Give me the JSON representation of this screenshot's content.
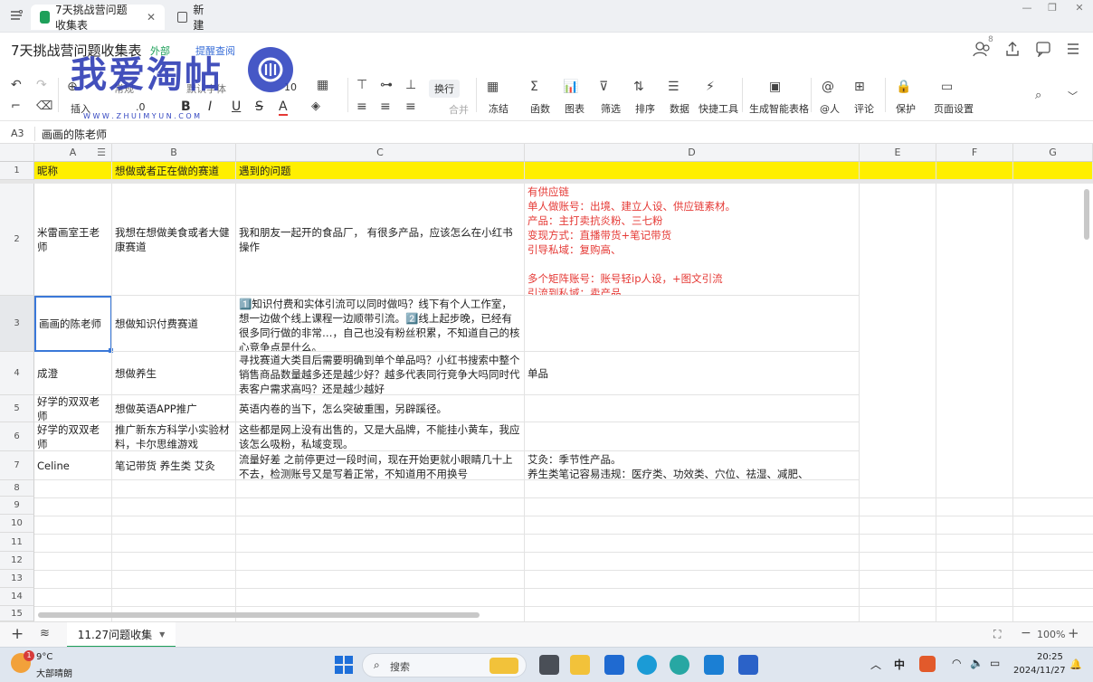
{
  "tabs": [
    {
      "label": "7天挑战营问题收集表"
    },
    {
      "label": "新建"
    }
  ],
  "doc": {
    "title": "7天挑战营问题收集表",
    "badge": "外部",
    "notify": "提醒查阅",
    "collab_count": "8"
  },
  "toolbar": {
    "insert": "插入",
    "normal": "常规",
    "font": "默认字体",
    "size": "10",
    "wrap": "换行",
    "merge": "合并",
    "decimal": ".0",
    "bold": "B",
    "italic": "I",
    "underline": "U",
    "strike": "S",
    "color": "A",
    "items": [
      "冻结",
      "函数",
      "图表",
      "筛选",
      "排序",
      "数据",
      "快捷工具",
      "生成智能表格",
      "@人",
      "评论",
      "保护",
      "页面设置"
    ]
  },
  "formula": {
    "ref": "A3",
    "value": "画画的陈老师"
  },
  "columns": [
    "A",
    "B",
    "C",
    "D",
    "E",
    "F",
    "G"
  ],
  "rows": [
    "1",
    "2",
    "3",
    "4",
    "5",
    "6",
    "7",
    "8",
    "9",
    "10",
    "11",
    "12",
    "13",
    "14",
    "15"
  ],
  "header_row": [
    "昵称",
    "想做或者正在做的赛道",
    "遇到的问题",
    ""
  ],
  "data": [
    {
      "a": "米雷画室王老师",
      "b": "我想在想做美食或者大健康赛道",
      "c": "我和朋友一起开的食品厂， 有很多产品，应该怎么在小红书操作",
      "d": [
        "有供应链",
        "单人做账号：出境、建立人设、供应链素材。",
        "产品：主打卖抗炎粉、三七粉",
        "变现方式：直播带货+笔记带货",
        "引导私域：复购高、",
        "",
        "多个矩阵账号：账号轻ip人设，+图文引流",
        "引流到私域：卖产品"
      ]
    },
    {
      "a": "画画的陈老师",
      "b": "想做知识付费赛道",
      "c": "1️⃣知识付费和实体引流可以同时做吗？线下有个人工作室，想一边做个线上课程一边顺带引流。2️⃣线上起步晚，已经有很多同行做的非常…，自己也没有粉丝积累，不知道自己的核心竞争点是什么。",
      "d": []
    },
    {
      "a": "成澄",
      "b": "想做养生",
      "c": "寻找赛道大类目后需要明确到单个单品吗？小红书搜索中整个销售商品数量越多还是越少好？越多代表同行竞争大吗同时代表客户需求高吗？还是越少越好",
      "d": [
        "单品"
      ]
    },
    {
      "a": "好学的双双老师",
      "b": "想做英语APP推广",
      "c": "英语内卷的当下，怎么突破重围，另辟蹊径。",
      "d": []
    },
    {
      "a": "好学的双双老师",
      "b": "推广新东方科学小实验材料，卡尔思维游戏",
      "c": "这些都是网上没有出售的，又是大品牌，不能挂小黄车，我应该怎么吸粉，私域变现。",
      "d": []
    },
    {
      "a": "Celine",
      "b": "笔记带货 养生类 艾灸",
      "c": "流量好差 之前停更过一段时间，现在开始更就小眼睛几十上不去，检测账号又是写着正常，不知道用不用换号",
      "d": [
        "艾灸：季节性产品。",
        "养生类笔记容易违规：医疗类、功效类、穴位、祛湿、减肥、"
      ]
    }
  ],
  "sheet": {
    "name": "11.27问题收集",
    "zoom": "100%"
  },
  "taskbar": {
    "temp": "9°C",
    "weather": "大部晴朗",
    "search": "搜索",
    "ime": "中",
    "time": "20:25",
    "date": "2024/11/27",
    "notif": "1"
  },
  "watermark": {
    "text": "我爱淘帖",
    "url": "W W W . Z H U I M Y U N . C O M"
  }
}
